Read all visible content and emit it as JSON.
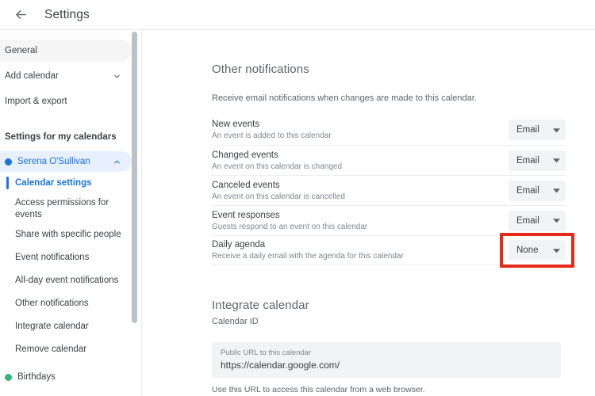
{
  "header": {
    "back_icon": "arrow-left-icon",
    "title": "Settings"
  },
  "sidebar": {
    "top_items": [
      {
        "label": "General",
        "icon": null
      },
      {
        "label": "Add calendar",
        "icon": "chevron-down-icon"
      },
      {
        "label": "Import & export",
        "icon": null
      }
    ],
    "section_label": "Settings for my calendars",
    "calendar": {
      "name": "Serena O'Sullivan",
      "dot_color": "#1a73e8",
      "expand_icon": "chevron-up-icon",
      "items": [
        {
          "label": "Calendar settings",
          "active": true
        },
        {
          "label": "Access permissions for events",
          "active": false
        },
        {
          "label": "Share with specific people",
          "active": false
        },
        {
          "label": "Event notifications",
          "active": false
        },
        {
          "label": "All-day event notifications",
          "active": false
        },
        {
          "label": "Other notifications",
          "active": false
        },
        {
          "label": "Integrate calendar",
          "active": false
        },
        {
          "label": "Remove calendar",
          "active": false
        }
      ]
    },
    "calendar2": {
      "name": "Birthdays",
      "dot_color": "#33b679"
    }
  },
  "main": {
    "other_notifications": {
      "title": "Other notifications",
      "description": "Receive email notifications when changes are made to this calendar.",
      "rows": [
        {
          "title": "New events",
          "subtitle": "An event is added to this calendar",
          "value": "Email",
          "highlighted": false
        },
        {
          "title": "Changed events",
          "subtitle": "An event on this calendar is changed",
          "value": "Email",
          "highlighted": false
        },
        {
          "title": "Canceled events",
          "subtitle": "An event on this calendar is cancelled",
          "value": "Email",
          "highlighted": false
        },
        {
          "title": "Event responses",
          "subtitle": "Guests respond to an event on this calendar",
          "value": "Email",
          "highlighted": false
        },
        {
          "title": "Daily agenda",
          "subtitle": "Receive a daily email with the agenda for this calendar",
          "value": "None",
          "highlighted": true
        }
      ]
    },
    "integrate_calendar": {
      "title": "Integrate calendar",
      "calendar_id_label": "Calendar ID",
      "public_url_label": "Public URL to this calendar",
      "public_url_value": "https://calendar.google.com/",
      "public_url_note": "Use this URL to access this calendar from a web browser."
    }
  },
  "colors": {
    "accent": "#1a73e8",
    "highlight": "#e52b18",
    "dropdown_bg": "#f1f3f4"
  }
}
